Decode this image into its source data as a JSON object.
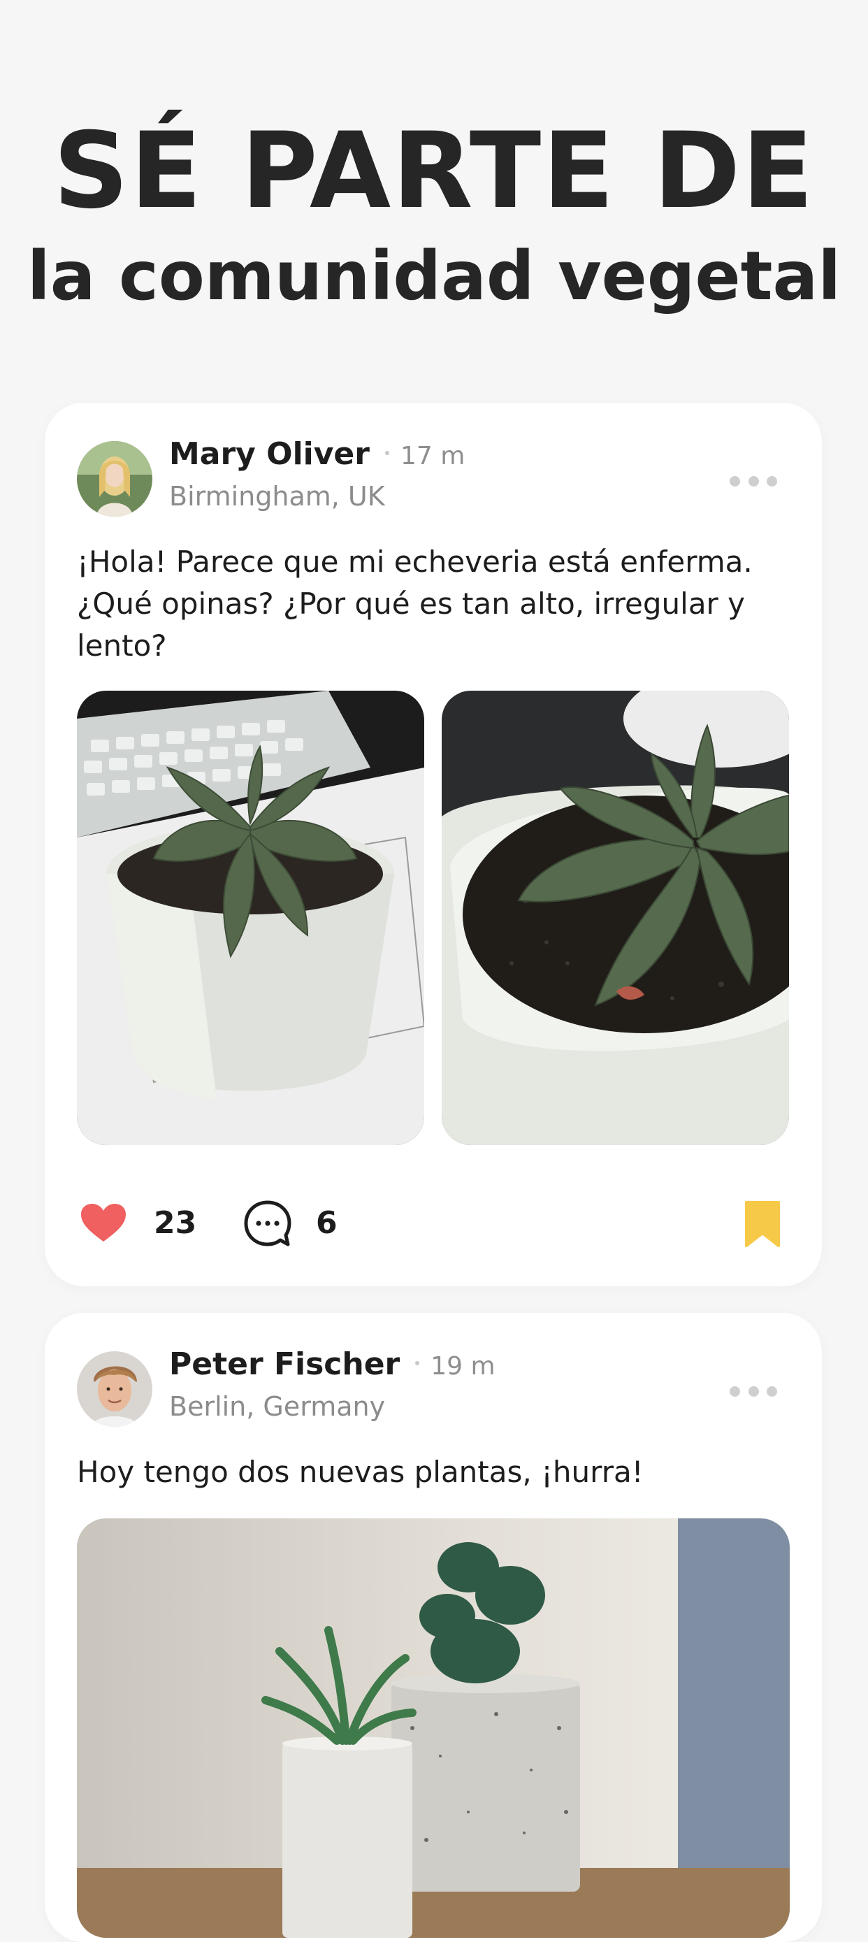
{
  "hero": {
    "line1": "SÉ PARTE DE",
    "line2": "la comunidad vegetal"
  },
  "colors": {
    "background": "#f6f6f6",
    "card": "#ffffff",
    "like": "#f06060",
    "bookmark": "#f7c948",
    "text_primary": "#1d1d1d",
    "text_secondary": "#8c8c8c"
  },
  "posts": [
    {
      "author": "Mary Oliver",
      "time": "17 m",
      "location": "Birmingham, UK",
      "text": "¡Hola! Parece que mi echeveria está enferma. ¿Qué opinas? ¿Por qué es tan alto, irregular y lento?",
      "likes": "23",
      "comments": "6",
      "bookmarked": true,
      "icons": [
        "heart-icon",
        "comment-icon",
        "bookmark-icon",
        "more-icon"
      ]
    },
    {
      "author": "Peter Fischer",
      "time": "19 m",
      "location": "Berlin, Germany",
      "text": "Hoy tengo dos nuevas plantas, ¡hurra!",
      "icons": [
        "more-icon"
      ]
    }
  ]
}
